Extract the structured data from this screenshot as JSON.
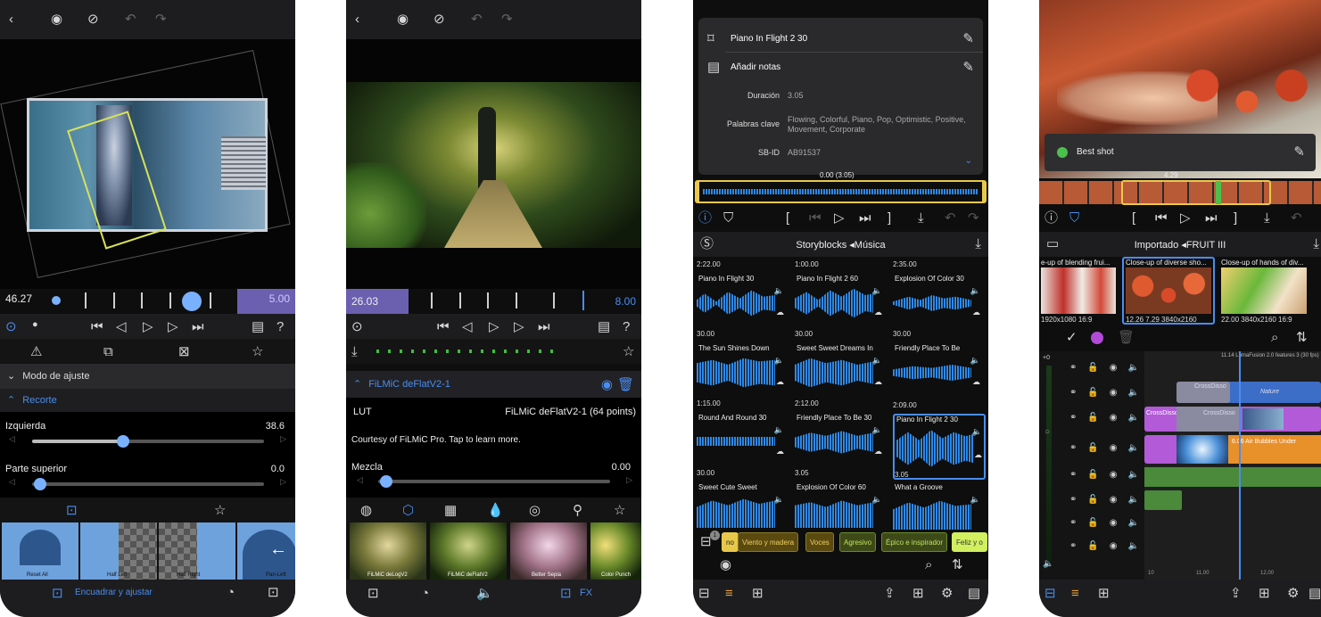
{
  "screen1": {
    "time_left": "46.27",
    "time_right": "5.00",
    "section_fit_mode": "Modo de ajuste",
    "section_crop": "Recorte",
    "left_label": "Izquierda",
    "left_value": "38.6",
    "top_label": "Parte superior",
    "top_value": "0.0",
    "presets": [
      "Reset All",
      "Half Left",
      "Half Right",
      "Pan-Left"
    ],
    "bottom_label": "Encuadrar y ajustar"
  },
  "screen2": {
    "time_left": "26.03",
    "time_right": "8.00",
    "effect_name": "FiLMiC deFlatV2-1",
    "lut_label": "LUT",
    "lut_value": "FiLMiC deFlatV2-1 (64 points)",
    "courtesy": "Courtesy of FiLMiC Pro. Tap to learn more.",
    "mix_label": "Mezcla",
    "mix_value": "0.00",
    "presets": [
      "FiLMiC deLogV2",
      "FiLMiC deFlatV2",
      "Better Sepia",
      "Color Punch"
    ],
    "fx_label": "FX"
  },
  "screen3": {
    "clip_title": "Piano In Flight 2 30",
    "add_notes": "Añadir notas",
    "duration_label": "Duración",
    "duration_value": "3.05",
    "keywords_label": "Palabras clave",
    "keywords_value": "Flowing, Colorful, Piano, Pop, Optimistic, Positive, Movement, Corporate",
    "sbid_label": "SB-ID",
    "sbid_value": "AB91537",
    "time_readout": "0.00 (3.05)",
    "browser_title": "Storyblocks ◂Música",
    "tracks": [
      {
        "dur": "2:22.00",
        "title": "Piano In Flight 30"
      },
      {
        "dur": "1:00.00",
        "title": "Piano In Flight 2 60"
      },
      {
        "dur": "2:35.00",
        "title": "Explosion Of Color 30"
      },
      {
        "dur": "30.00",
        "title": "The Sun Shines Down Full"
      },
      {
        "dur": "30.00",
        "title": "Sweet Sweet Dreams Ins..."
      },
      {
        "dur": "30.00",
        "title": "Friendly Place To Be"
      },
      {
        "dur": "1:15.00",
        "title": "Round And Round 30"
      },
      {
        "dur": "2:12.00",
        "title": "Friendly Place To Be 30"
      },
      {
        "dur": "2:09.00",
        "title": "Piano In Flight 2 30"
      },
      {
        "dur": "30.00",
        "title": "Sweet Cute Sweet"
      },
      {
        "dur": "3.05",
        "title": "Explosion Of Color 60"
      },
      {
        "dur": "3.05",
        "title": "What a Groove"
      }
    ],
    "tags": [
      "no",
      "Viento y madera",
      "Voces",
      "Agresivo",
      "Épico e inspirador",
      "Feliz y o"
    ],
    "badge_count": "1"
  },
  "screen4": {
    "note_label": "Best shot",
    "time_marker": "4.29",
    "browser_title": "Importado ◂FRUIT III",
    "clips": [
      {
        "title": "e-up of blending frui...",
        "meta": "1920x1080  16:9"
      },
      {
        "title": "Close-up of diverse sho...",
        "meta": "12.26  7.29  3840x2160"
      },
      {
        "title": "Close-up of hands of div...",
        "meta": "22.00  3840x2160  16:9"
      }
    ],
    "track_zero": "+0",
    "timeline_header": "11.14  LumaFusion 2.0 features 3 (30 fps)",
    "clip_labels": [
      "CrossDisso",
      "Nature",
      "CrossDisso",
      "CrossDisso",
      "6.06  Air Bubbles Under"
    ],
    "ruler": [
      "10",
      "11,00",
      "12,00"
    ]
  },
  "colors": {
    "accent": "#4a8df0",
    "waveform": "#2f88e6",
    "time_box": "#6b5fb0",
    "selection": "#e8c84a"
  }
}
